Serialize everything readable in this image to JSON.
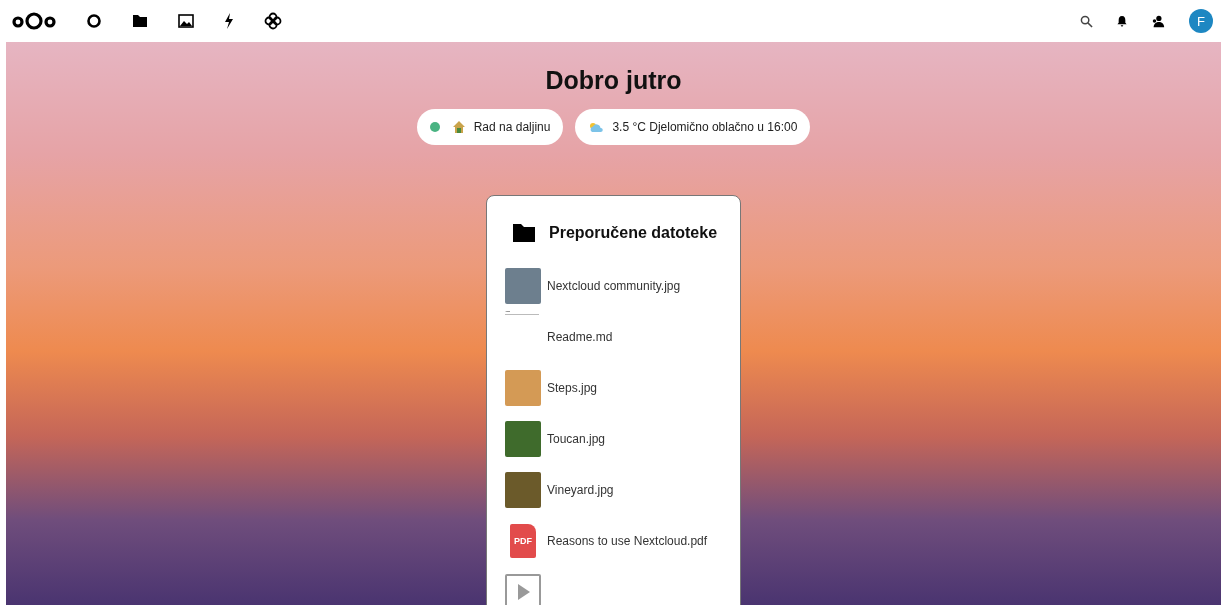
{
  "header": {
    "avatar_letter": "F"
  },
  "greeting": "Dobro jutro",
  "status": {
    "color": "#49b382",
    "label": "Rad na daljinu"
  },
  "weather": {
    "label": "3.5 °C Djelomično oblačno u 16:00"
  },
  "widget": {
    "title": "Preporučene datoteke",
    "files": [
      {
        "kind": "photo",
        "name": "Nextcloud community.jpg",
        "color": "#6d7f8e"
      },
      {
        "kind": "document",
        "name": "Readme.md"
      },
      {
        "kind": "photo",
        "name": "Steps.jpg",
        "color": "#d49a55"
      },
      {
        "kind": "photo",
        "name": "Toucan.jpg",
        "color": "#3f6b2c"
      },
      {
        "kind": "photo",
        "name": "Vineyard.jpg",
        "color": "#6b5a2a"
      },
      {
        "kind": "pdf",
        "name": "Reasons to use Nextcloud.pdf",
        "badge": "PDF"
      },
      {
        "kind": "video"
      }
    ]
  }
}
